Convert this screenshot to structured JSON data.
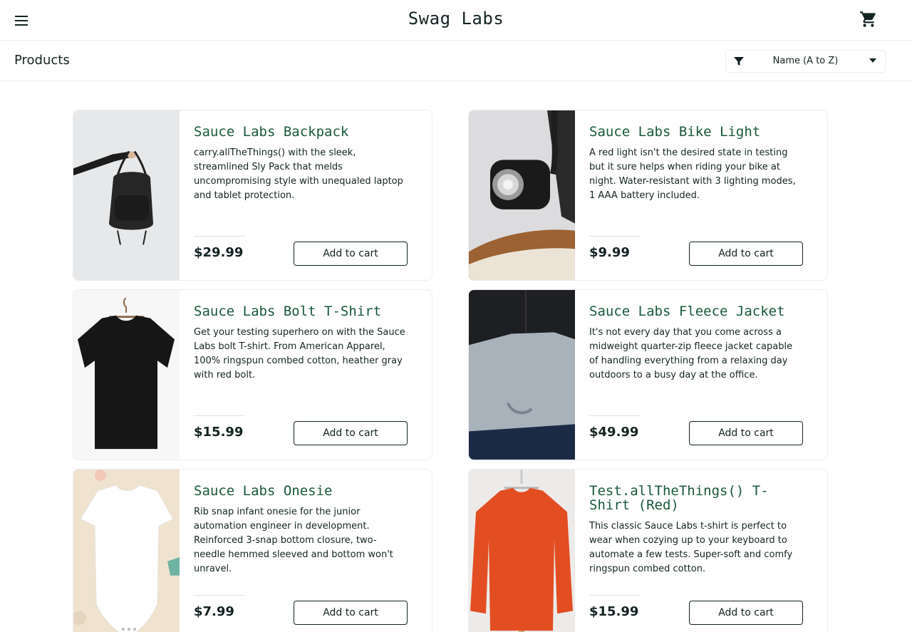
{
  "header": {
    "menu_icon": "hamburger-menu-icon",
    "title": "Swag Labs",
    "cart_icon": "shopping-cart-icon"
  },
  "subheader": {
    "title": "Products",
    "sort": {
      "icon": "filter-icon",
      "selected": "Name (A to Z)",
      "caret_icon": "caret-down-icon"
    }
  },
  "products": [
    {
      "name": "Sauce Labs Backpack",
      "description": "carry.allTheThings() with the sleek, streamlined Sly Pack that melds uncompromising style with unequaled laptop and tablet protection.",
      "price": "$29.99",
      "button": "Add to cart",
      "image": "backpack-image"
    },
    {
      "name": "Sauce Labs Bike Light",
      "description": "A red light isn't the desired state in testing but it sure helps when riding your bike at night. Water-resistant with 3 lighting modes, 1 AAA battery included.",
      "price": "$9.99",
      "button": "Add to cart",
      "image": "bike-light-image"
    },
    {
      "name": "Sauce Labs Bolt T-Shirt",
      "description": "Get your testing superhero on with the Sauce Labs bolt T-shirt. From American Apparel, 100% ringspun combed cotton, heather gray with red bolt.",
      "price": "$15.99",
      "button": "Add to cart",
      "image": "bolt-tshirt-image"
    },
    {
      "name": "Sauce Labs Fleece Jacket",
      "description": "It's not every day that you come across a midweight quarter-zip fleece jacket capable of handling everything from a relaxing day outdoors to a busy day at the office.",
      "price": "$49.99",
      "button": "Add to cart",
      "image": "fleece-jacket-image"
    },
    {
      "name": "Sauce Labs Onesie",
      "description": "Rib snap infant onesie for the junior automation engineer in development. Reinforced 3-snap bottom closure, two-needle hemmed sleeved and bottom won't unravel.",
      "price": "$7.99",
      "button": "Add to cart",
      "image": "onesie-image"
    },
    {
      "name": "Test.allTheThings() T-Shirt (Red)",
      "description": "This classic Sauce Labs t-shirt is perfect to wear when cozying up to your keyboard to automate a few tests. Super-soft and comfy ringspun combed cotton.",
      "price": "$15.99",
      "button": "Add to cart",
      "image": "red-tshirt-image"
    }
  ],
  "colors": {
    "product_name": "#18583a",
    "text": "#132322",
    "border": "#ededed"
  }
}
